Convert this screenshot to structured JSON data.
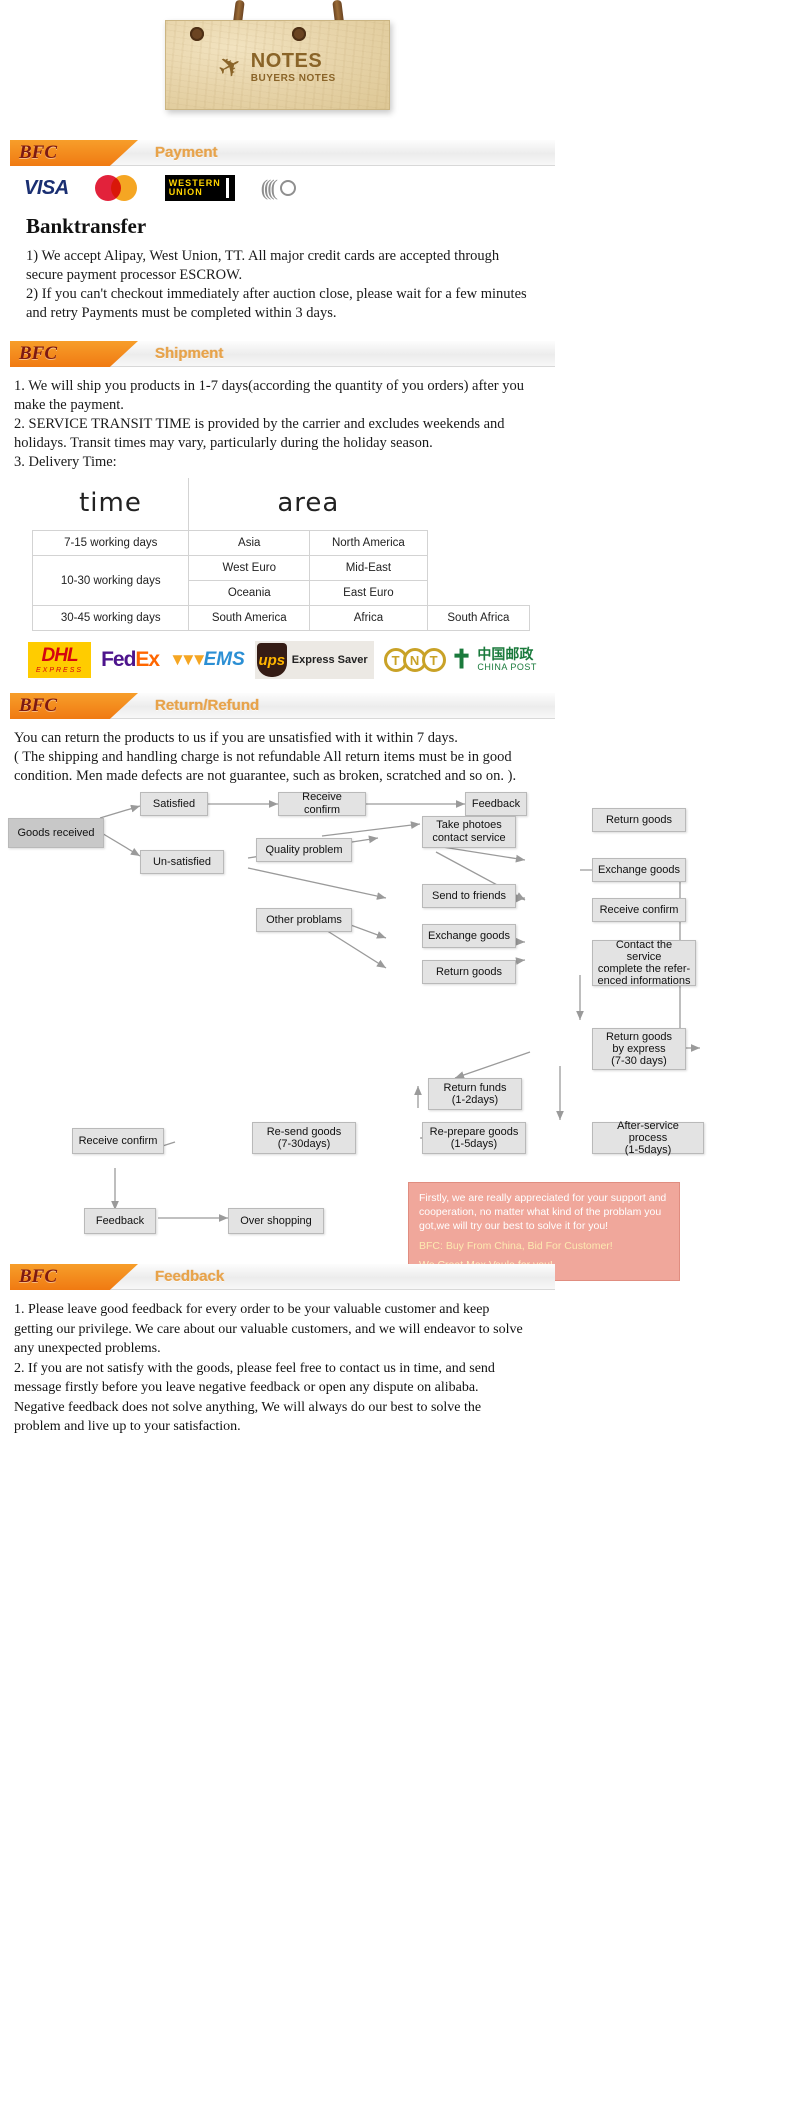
{
  "banner": {
    "title": "NOTES",
    "subtitle": "BUYERS NOTES",
    "icon": "airplane-icon"
  },
  "sections": {
    "payment": {
      "badge": "BFC",
      "label": "Payment",
      "logos": [
        {
          "name": "visa-logo",
          "text": "VISA"
        },
        {
          "name": "mastercard-logo",
          "text": ""
        },
        {
          "name": "western-union-logo",
          "line1": "WESTERN",
          "line2": "UNION"
        },
        {
          "name": "contactless-icon",
          "text": ""
        }
      ],
      "heading": "Banktransfer",
      "items": [
        "1) We accept Alipay, West Union, TT. All major credit cards are accepted through",
        "    secure payment processor ESCROW.",
        "2) If you can't checkout immediately after auction close, please wait for a few minutes",
        "    and retry Payments must be completed within 3 days."
      ]
    },
    "shipment": {
      "badge": "BFC",
      "label": "Shipment",
      "items": [
        "1. We will ship you products in 1-7 days(according the quantity of you orders) after you",
        "make the payment.",
        "2. SERVICE TRANSIT TIME is provided by the carrier and excludes weekends and",
        " holidays. Transit times may vary, particularly during the holiday season.",
        "3. Delivery Time:"
      ],
      "table": {
        "headers": [
          "time",
          "area",
          ""
        ],
        "rows": [
          {
            "time": "7-15 working days",
            "c1": "Asia",
            "c2": "North America",
            "c3": ""
          },
          {
            "time": "10-30 working days",
            "c1": "West Euro",
            "c2": "Mid-East",
            "c3": ""
          },
          {
            "time": "",
            "c1": "Oceania",
            "c2": "East Euro",
            "c3": ""
          },
          {
            "time": "30-45 working days",
            "c1": "South America",
            "c2": "Africa",
            "c3": "South Africa"
          }
        ]
      },
      "carriers": [
        {
          "name": "dhl-logo",
          "main": "DHL",
          "sub": "EXPRESS"
        },
        {
          "name": "fedex-logo",
          "part1": "Fed",
          "part2": "Ex"
        },
        {
          "name": "ems-logo",
          "text": "EMS"
        },
        {
          "name": "ups-logo",
          "mark": "ups",
          "text": "Express Saver"
        },
        {
          "name": "tnt-logo",
          "letters": [
            "T",
            "N",
            "T"
          ]
        },
        {
          "name": "china-post-logo",
          "cn": "中国邮政",
          "en": "CHINA POST"
        }
      ]
    },
    "return": {
      "badge": "BFC",
      "label": "Return/Refund",
      "items": [
        "     You can return the products to us if you are unsatisfied with it within 7 days.",
        "( The shipping and handling charge is not refundable All return items must be in good",
        "condition. Men made defects are not guarantee, such as broken, scratched and so on. )."
      ],
      "flow_nodes": [
        {
          "id": "goods-received",
          "label": "Goods received"
        },
        {
          "id": "satisfied",
          "label": "Satisfied"
        },
        {
          "id": "receive-confirm-1",
          "label": "Receive confirm"
        },
        {
          "id": "feedback-1",
          "label": "Feedback"
        },
        {
          "id": "un-satisfied",
          "label": "Un-satisfied"
        },
        {
          "id": "quality-problem",
          "label": "Quality problem"
        },
        {
          "id": "other-problems",
          "label": "Other problams"
        },
        {
          "id": "take-photoes",
          "label": "Take photoes\ncontact service"
        },
        {
          "id": "send-to-friends",
          "label": "Send to friends"
        },
        {
          "id": "exchange-goods-1",
          "label": "Exchange goods"
        },
        {
          "id": "return-goods-1",
          "label": "Return goods"
        },
        {
          "id": "return-goods-2",
          "label": "Return goods"
        },
        {
          "id": "exchange-goods-2",
          "label": "Exchange goods"
        },
        {
          "id": "receive-confirm-2",
          "label": "Receive confirm"
        },
        {
          "id": "contact-the-service",
          "label": "Contact the service\ncomplete the refer-\nenced informations"
        },
        {
          "id": "return-goods-express",
          "label": "Return goods\nby express\n(7-30 days)"
        },
        {
          "id": "return-funds",
          "label": "Return funds\n(1-2days)"
        },
        {
          "id": "after-service-process",
          "label": "After-service process\n(1-5days)"
        },
        {
          "id": "re-prepare-goods",
          "label": "Re-prepare goods\n(1-5days)"
        },
        {
          "id": "re-send-goods",
          "label": "Re-send goods\n(7-30days)"
        },
        {
          "id": "receive-confirm-3",
          "label": "Receive confirm"
        },
        {
          "id": "feedback-2",
          "label": "Feedback"
        },
        {
          "id": "over-shopping",
          "label": "Over shopping"
        }
      ],
      "callout": {
        "line1": "Firstly, we are really appreciated for your support and cooperation, no matter what kind of the problam you got,we will try our best to solve it for you!",
        "line2": "BFC: Buy From China, Bid For Customer!",
        "line3": "We Creat Max Vaule for you!"
      }
    },
    "feedback": {
      "badge": "BFC",
      "label": "Feedback",
      "items": [
        "1. Please leave good feedback for every order to be your valuable customer and keep",
        "getting our privilege. We care about our valuable customers, and we will endeavor to solve",
        "any unexpected problems.",
        "2. If you are not satisfy with the goods, please feel free to contact us in time, and send",
        "message firstly before you leave negative feedback or open any dispute on alibaba.",
        "Negative feedback does not solve anything, We will always do our best to solve the",
        "problem and live up to your satisfaction."
      ]
    }
  },
  "colors": {
    "accent_orange": "#f07a12",
    "badge_text": "#7d1a12",
    "label_gold": "#e8a34a",
    "callout_bg": "#f0a79b",
    "node_bg": "#e3e3e3"
  }
}
